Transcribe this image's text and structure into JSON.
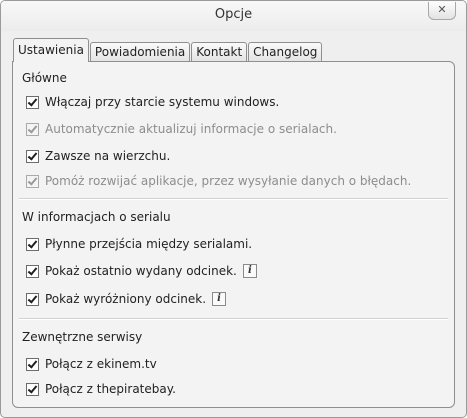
{
  "window": {
    "title": "Opcje",
    "close_icon_glyph": "✕"
  },
  "tabs": [
    {
      "label": "Ustawienia",
      "active": true
    },
    {
      "label": "Powiadomienia",
      "active": false
    },
    {
      "label": "Kontakt",
      "active": false
    },
    {
      "label": "Changelog",
      "active": false
    }
  ],
  "sections": {
    "main": {
      "title": "Główne",
      "options": [
        {
          "label": "Włączaj przy starcie systemu windows.",
          "checked": true,
          "enabled": true
        },
        {
          "label": "Automatycznie aktualizuj informacje o serialach.",
          "checked": true,
          "enabled": false
        },
        {
          "label": "Zawsze na wierzchu.",
          "checked": true,
          "enabled": true
        },
        {
          "label": "Pomóż rozwijać aplikacje, przez wysyłanie danych o błędach.",
          "checked": true,
          "enabled": false
        }
      ]
    },
    "series_info": {
      "title": "W informacjach o serialu",
      "options": [
        {
          "label": "Płynne przejścia między serialami.",
          "checked": true,
          "enabled": true
        },
        {
          "label": "Pokaż ostatnio wydany odcinek.",
          "checked": true,
          "enabled": true,
          "info_icon": "i"
        },
        {
          "label": "Pokaż wyróżniony odcinek.",
          "checked": true,
          "enabled": true,
          "info_icon": "i"
        }
      ]
    },
    "external": {
      "title": "Zewnętrzne serwisy",
      "options": [
        {
          "label": "Połącz z ekinem.tv",
          "checked": true,
          "enabled": true
        },
        {
          "label": "Połącz z thepiratebay.",
          "checked": true,
          "enabled": true
        }
      ]
    }
  }
}
